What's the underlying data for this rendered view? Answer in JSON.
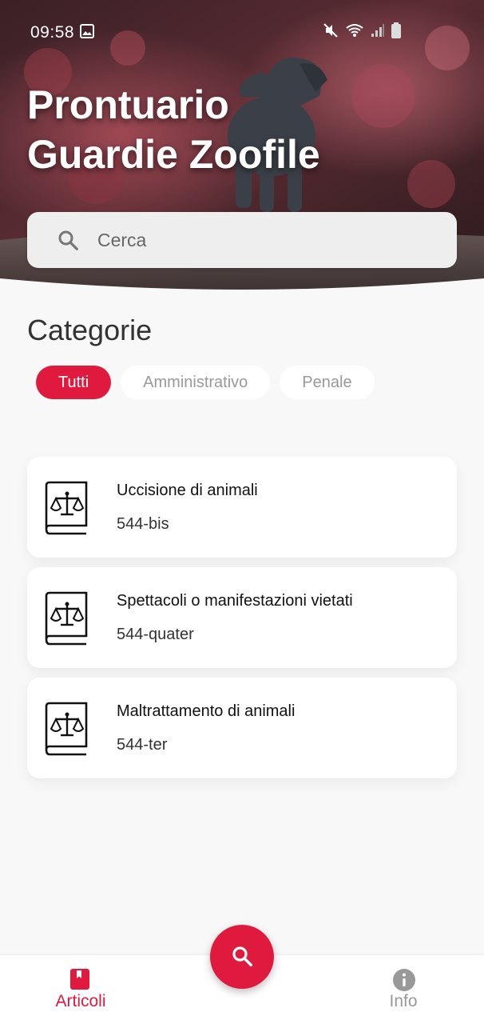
{
  "status_bar": {
    "time": "09:58"
  },
  "header": {
    "title_line1": "Prontuario",
    "title_line2": "Guardie Zoofile"
  },
  "search": {
    "placeholder": "Cerca"
  },
  "categories": {
    "title": "Categorie",
    "chips": [
      {
        "label": "Tutti",
        "active": true
      },
      {
        "label": "Amministrativo",
        "active": false
      },
      {
        "label": "Penale",
        "active": false
      }
    ]
  },
  "articles": [
    {
      "title": "Uccisione di animali",
      "code": "544-bis",
      "icon": "law-book-icon"
    },
    {
      "title": "Spettacoli o manifestazioni vietati",
      "code": "544-quater",
      "icon": "law-book-icon"
    },
    {
      "title": "Maltrattamento di animali",
      "code": "544-ter",
      "icon": "law-book-icon"
    }
  ],
  "bottom_nav": {
    "items": [
      {
        "label": "Articoli",
        "icon": "bookmark-icon",
        "active": true
      },
      {
        "label": "Info",
        "icon": "info-icon",
        "active": false
      }
    ],
    "fab_icon": "search-icon"
  },
  "colors": {
    "accent": "#e01a3f",
    "background": "#f8f8f8",
    "card": "#ffffff",
    "inactive": "#999999"
  }
}
